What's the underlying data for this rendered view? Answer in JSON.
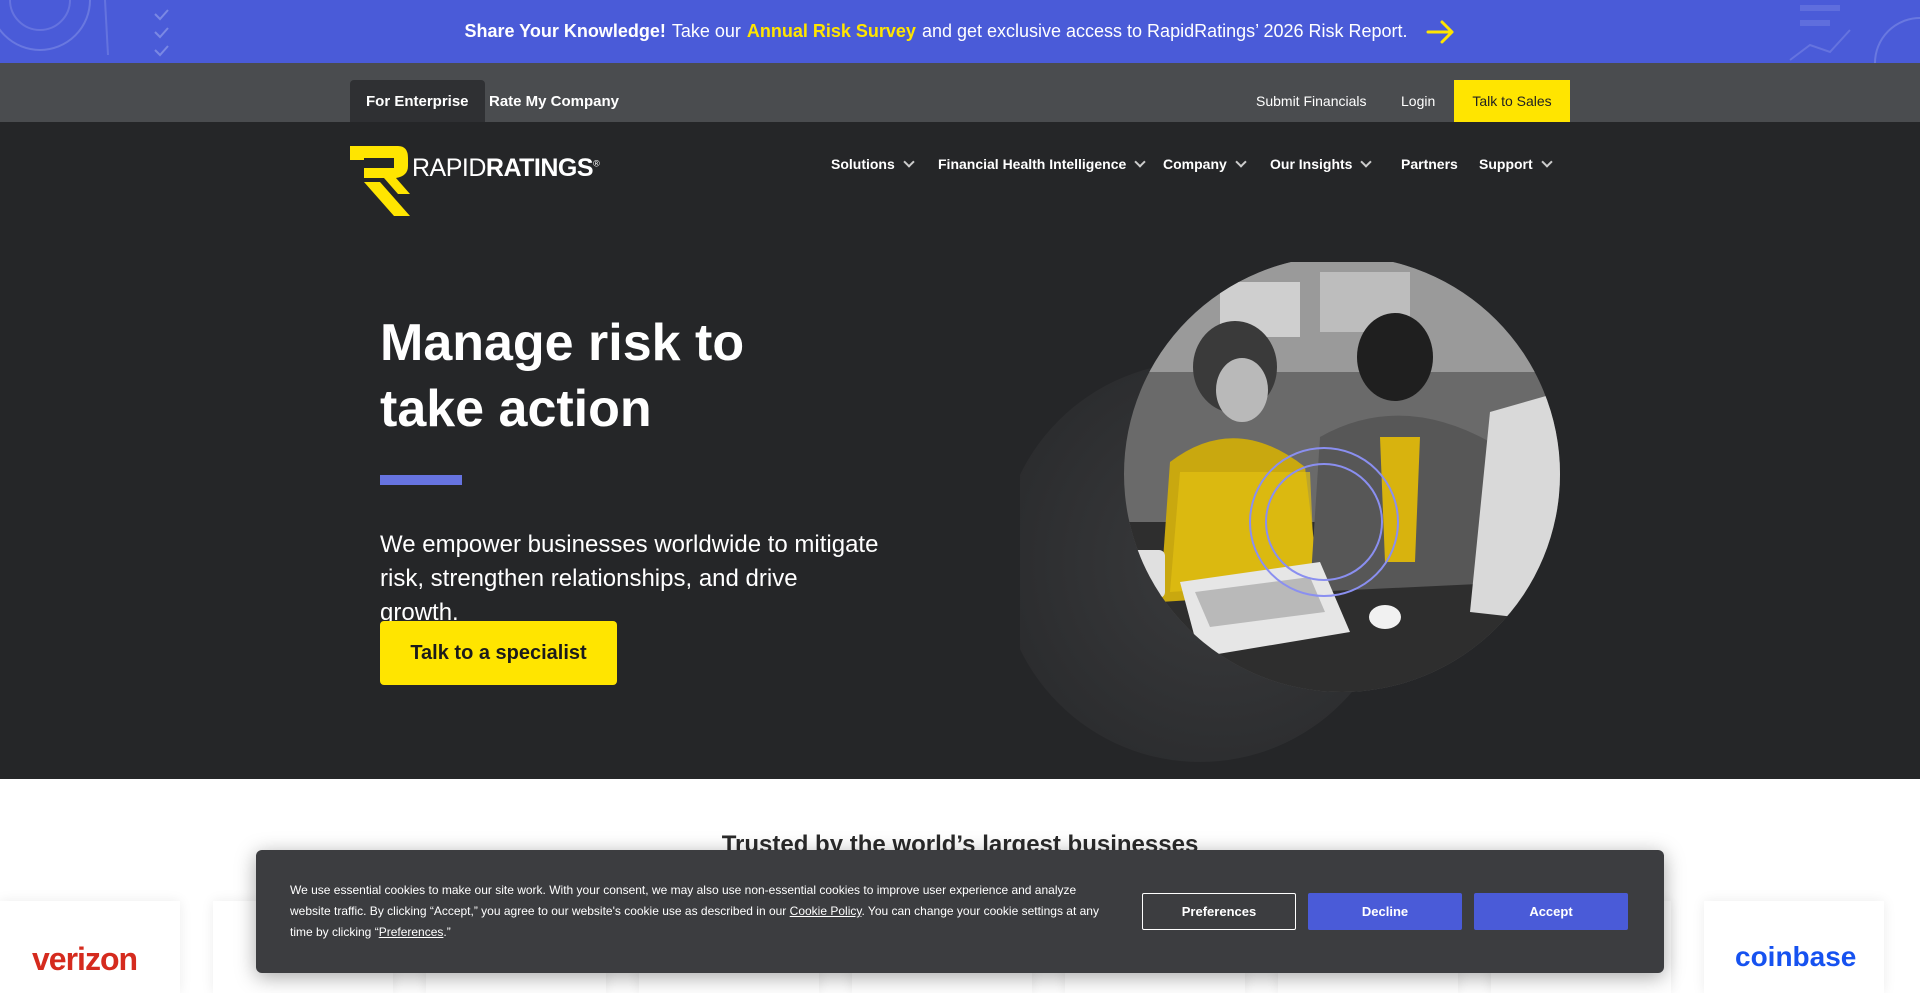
{
  "announcement": {
    "lead": "Share Your Knowledge!",
    "pre": "Take our",
    "highlight": "Annual Risk Survey",
    "post": "and get exclusive access to RapidRatings’ 2026 Risk Report."
  },
  "utility": {
    "tabs": [
      "For Enterprise",
      "Rate My Company"
    ],
    "links": [
      "Submit Financials",
      "Login"
    ],
    "cta": "Talk to Sales"
  },
  "brand": {
    "light": "RAPID",
    "bold": "RATINGS",
    "mark": "®"
  },
  "nav": {
    "items": [
      {
        "label": "Solutions",
        "dropdown": true
      },
      {
        "label": "Financial Health Intelligence",
        "dropdown": true
      },
      {
        "label": "Company",
        "dropdown": true
      },
      {
        "label": "Our Insights",
        "dropdown": true
      },
      {
        "label": "Partners",
        "dropdown": false
      },
      {
        "label": "Support",
        "dropdown": true
      }
    ]
  },
  "hero": {
    "headline_1": "Manage risk to",
    "headline_2": "take action",
    "subtext": "We empower businesses worldwide to mitigate risk, strengthen relationships, and drive growth.",
    "cta": "Talk to a specialist"
  },
  "trusted": {
    "title": "Trusted by the world’s largest businesses",
    "logos": [
      "verizon",
      "coinbase"
    ]
  },
  "cookie": {
    "text_1": "We use essential cookies to make our site work. With your consent, we may also use non-essential cookies to improve user experience and analyze website traffic. By clicking “Accept,” you agree to our website's cookie use as described in our",
    "policy_link": "Cookie Policy",
    "text_2": ". You can change your cookie settings at any time by clicking “",
    "pref_link": "Preferences",
    "text_3": ".”",
    "buttons": {
      "preferences": "Preferences",
      "decline": "Decline",
      "accept": "Accept"
    }
  },
  "colors": {
    "banner": "#4a5bd8",
    "yellow": "#ffe500",
    "dark": "#252628",
    "accent": "#6673e0"
  }
}
